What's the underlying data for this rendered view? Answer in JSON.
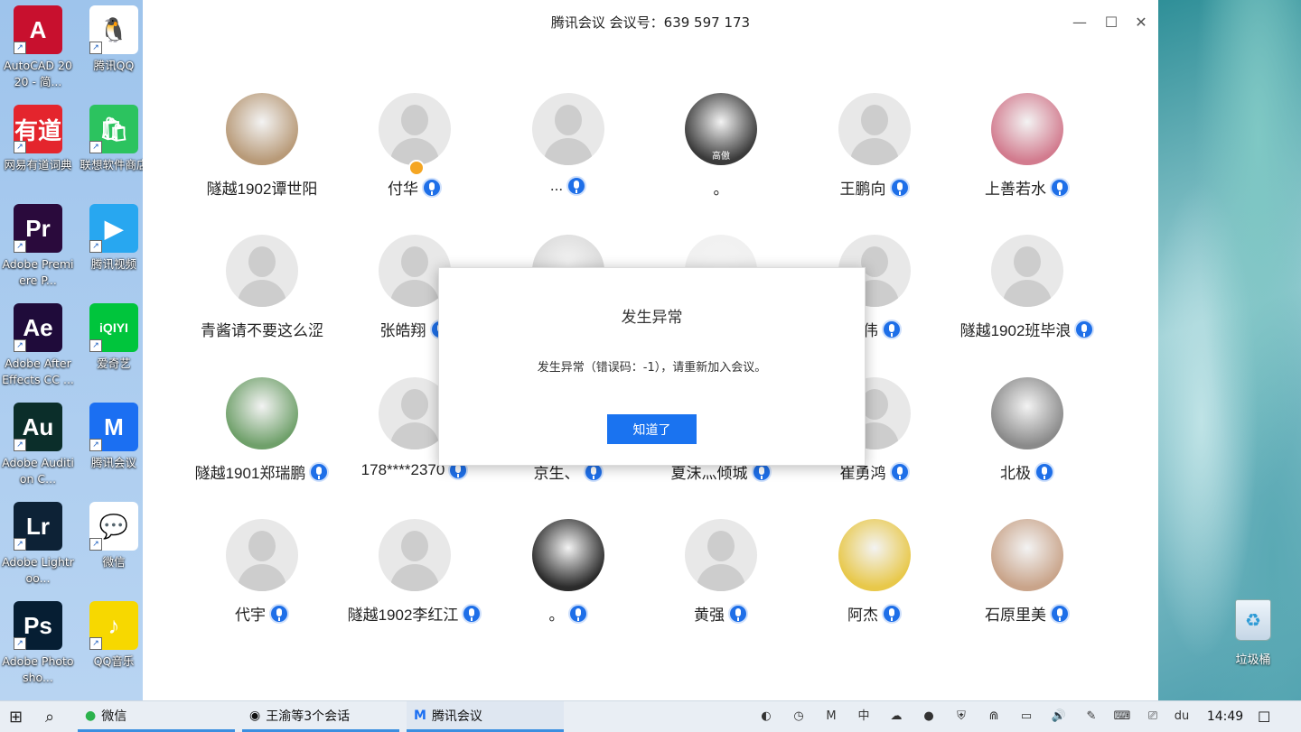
{
  "desktop": {
    "left_icons": [
      {
        "label": "AutoCAD 2020 - 简...",
        "glyph": "A",
        "color": "#c8102e",
        "icon": "autocad-icon"
      },
      {
        "label": "腾讯QQ",
        "glyph": "🐧",
        "color": "#ffffff",
        "icon": "qq-icon"
      },
      {
        "label": "网易有道词典",
        "glyph": "有道",
        "color": "#e4252d",
        "icon": "youdao-icon"
      },
      {
        "label": "联想软件商店",
        "glyph": "🛍",
        "color": "#2cc35f",
        "icon": "lenovo-store-icon"
      },
      {
        "label": "Adobe Premiere P...",
        "glyph": "Pr",
        "color": "#2a0a3c",
        "icon": "premiere-icon"
      },
      {
        "label": "腾讯视频",
        "glyph": "▶",
        "color": "#28a7f0",
        "icon": "tencent-video-icon"
      },
      {
        "label": "Adobe After Effects CC ...",
        "glyph": "Ae",
        "color": "#1f0b3a",
        "icon": "after-effects-icon"
      },
      {
        "label": "爱奇艺",
        "glyph": "iQIYI",
        "color": "#00c53c",
        "icon": "iqiyi-icon"
      },
      {
        "label": "Adobe Audition C...",
        "glyph": "Au",
        "color": "#0b2e2a",
        "icon": "audition-icon"
      },
      {
        "label": "腾讯会议",
        "glyph": "M",
        "color": "#1b6ff2",
        "icon": "tencent-meeting-icon"
      },
      {
        "label": "Adobe Lightroo...",
        "glyph": "Lr",
        "color": "#0d2236",
        "icon": "lightroom-icon"
      },
      {
        "label": "微信",
        "glyph": "💬",
        "color": "#ffffff",
        "icon": "wechat-icon"
      },
      {
        "label": "Adobe Photosho...",
        "glyph": "Ps",
        "color": "#061e33",
        "icon": "photoshop-icon"
      },
      {
        "label": "QQ音乐",
        "glyph": "♪",
        "color": "#f7d800",
        "icon": "qq-music-icon"
      }
    ],
    "recycle_bin": {
      "label": "垃圾桶",
      "glyph": "♻"
    }
  },
  "window": {
    "title": "腾讯会议 会议号：639 597 173",
    "controls": {
      "minimize": "—",
      "maximize": "☐",
      "close": "✕"
    }
  },
  "participants": [
    {
      "name": "隧越1902谭世阳",
      "photo": true,
      "tone": "#b89a78",
      "mic": false
    },
    {
      "name": "付华",
      "photo": false,
      "mic": true,
      "host": true
    },
    {
      "name": "...",
      "photo": false,
      "mic": true
    },
    {
      "name": "。",
      "photo": true,
      "tone": "#3a3a3a",
      "mic": false,
      "caption": "高傲"
    },
    {
      "name": "王鹏向",
      "photo": false,
      "mic": true
    },
    {
      "name": "上善若水",
      "photo": true,
      "tone": "#d27b8e",
      "mic": true
    },
    {
      "name": "青酱请不要这么涩",
      "photo": false,
      "mic": false
    },
    {
      "name": "张皓翔",
      "photo": false,
      "mic": true
    },
    {
      "name": "",
      "photo": true,
      "tone": "#d9d9d9",
      "mic": false
    },
    {
      "name": "",
      "photo": true,
      "tone": "#f0f0f0",
      "mic": false
    },
    {
      "name": "本伟",
      "photo": false,
      "mic": true
    },
    {
      "name": "隧越1902班毕浪",
      "photo": false,
      "mic": true
    },
    {
      "name": "隧越1901郑瑞鹏",
      "photo": true,
      "tone": "#6fa06a",
      "mic": true
    },
    {
      "name": "178****2370",
      "photo": false,
      "mic": true
    },
    {
      "name": "京生、",
      "photo": false,
      "mic": true
    },
    {
      "name": "夏沫灬倾城",
      "photo": false,
      "mic": true
    },
    {
      "name": "崔勇鸿",
      "photo": false,
      "mic": true
    },
    {
      "name": "北极",
      "photo": true,
      "tone": "#8a8a8a",
      "mic": true
    },
    {
      "name": "代宇",
      "photo": false,
      "mic": true
    },
    {
      "name": "隧越1902李红江",
      "photo": false,
      "mic": true
    },
    {
      "name": "。",
      "photo": true,
      "tone": "#2b2b2b",
      "mic": true
    },
    {
      "name": "黄强",
      "photo": false,
      "mic": true
    },
    {
      "name": "阿杰",
      "photo": true,
      "tone": "#e8c84a",
      "mic": true
    },
    {
      "name": "石原里美",
      "photo": true,
      "tone": "#c9a48a",
      "mic": true
    }
  ],
  "dialog": {
    "title": "发生异常",
    "message": "发生异常（错误码：-1），请重新加入会议。",
    "ok_label": "知道了"
  },
  "taskbar": {
    "start_icon": "windows-icon",
    "search_icon": "search-icon",
    "apps": [
      {
        "label": "微信",
        "icon": "wechat-icon"
      },
      {
        "label": "王渝等3个会话",
        "icon": "qq-icon"
      },
      {
        "label": "腾讯会议",
        "icon": "tencent-meeting-icon"
      }
    ],
    "tray_glyphs": [
      "◐",
      "◷",
      "M",
      "中",
      "☁",
      "●",
      "⛨",
      "⋒",
      "▭",
      "🔊",
      "✎",
      "⌨",
      "⎚",
      "du"
    ],
    "time": "14:49",
    "notification_glyph": "☐"
  }
}
